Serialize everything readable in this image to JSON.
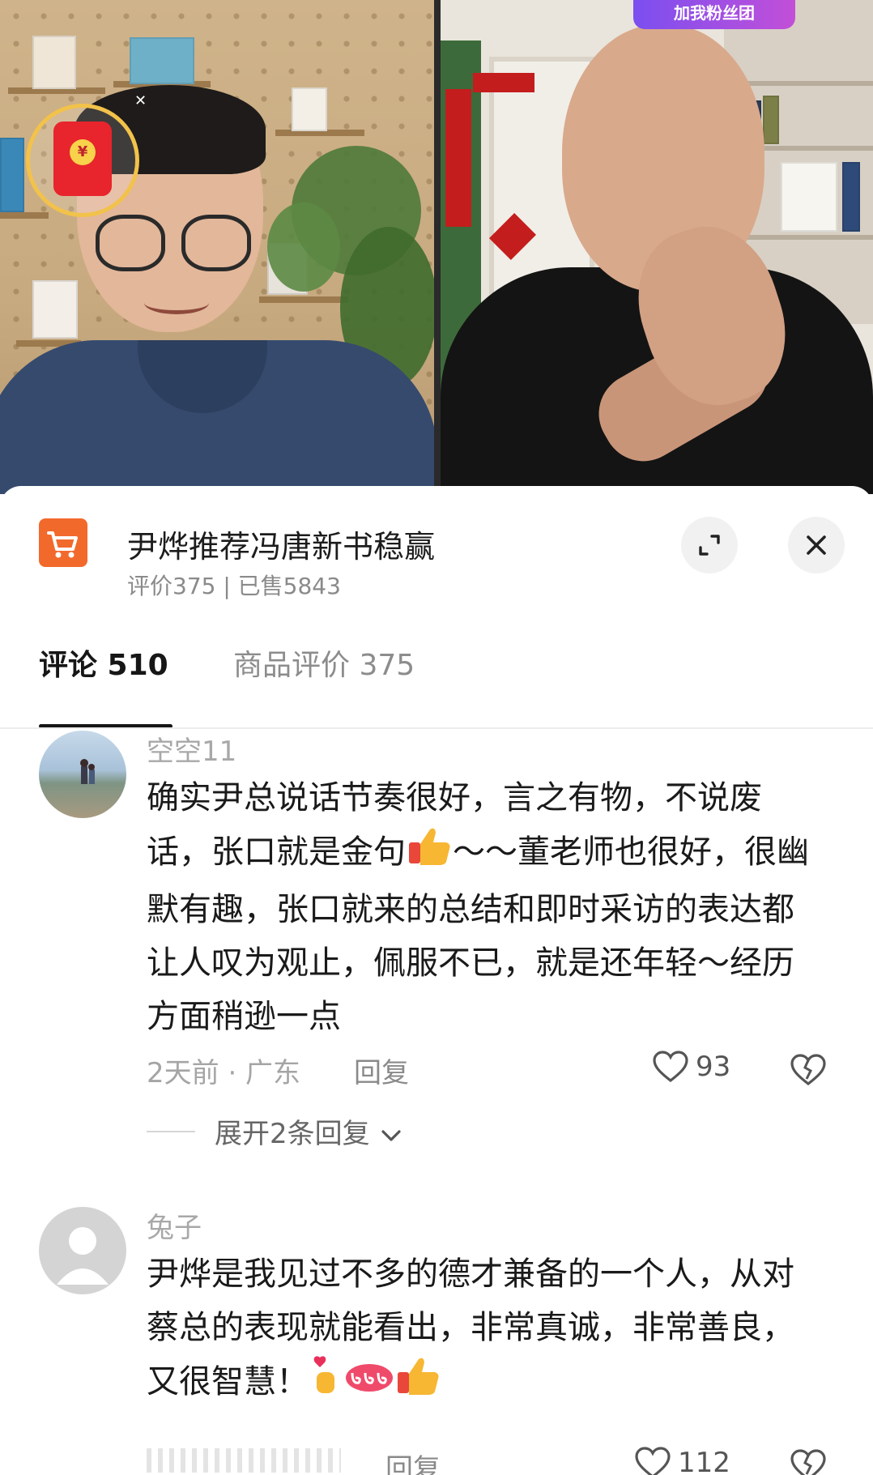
{
  "live_badge": "加我粉丝团",
  "product": {
    "title": "尹烨推荐冯唐新书稳赢",
    "meta": "评价375 | 已售5843"
  },
  "tabs": [
    {
      "label": "评论 510",
      "active": true
    },
    {
      "label": "商品评价 375",
      "active": false
    }
  ],
  "comments": [
    {
      "username": "空空11",
      "text": "确实尹总说话节奏很好，言之有物，不说废话，张口就是金句",
      "text_after_emoji": "～～董老师也很好，很幽默有趣，张口就来的总结和即时采访的表达都让人叹为观止，佩服不已，就是还年轻～经历方面稍逊一点",
      "time_location": "2天前 · 广东",
      "reply_label": "回复",
      "likes": "93",
      "expand_label": "展开2条回复"
    },
    {
      "username": "兔子",
      "text": "尹烨是我见过不多的德才兼备的一个人，从对蔡总的表现就能看出，非常真诚，非常善良，又很智慧！",
      "reply_label": "回复",
      "likes": "112"
    }
  ],
  "colors": {
    "cart_orange": "#f2692c",
    "text_primary": "#1a1a1a",
    "text_secondary": "#8a8a8a",
    "red_packet": "#e8242c"
  },
  "icons": [
    "cart-icon",
    "expand-icon",
    "close-icon",
    "heart-icon",
    "broken-heart-icon",
    "chevron-down-icon",
    "red-packet-icon",
    "thumbs-up-emoji",
    "finger-heart-emoji"
  ]
}
